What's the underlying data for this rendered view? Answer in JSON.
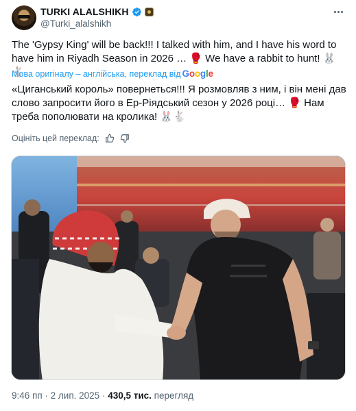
{
  "author": {
    "display_name": "TURKI ALALSHIKH",
    "handle": "@Turki_alalshikh"
  },
  "tweet": {
    "text_part1": "The 'Gypsy King' will be back!!! I talked with him, and I have his word to have him in Riyadh Season in 2026 … ",
    "text_part2": " We have a rabbit to hunt! ",
    "glove_emoji": "🥊",
    "rabbit_emoji": "🐰🐇"
  },
  "translation": {
    "note": "Мова оригіналу – англійська, переклад від",
    "provider": "Google",
    "text_part1": "«Циганський король» повернеться!!! Я розмовляв з ним, і він мені дав слово запросити його в Ер-Ріядський сезон у 2026 році… ",
    "text_part2": " Нам треба пополювати на кролика! ",
    "rate_label": "Оцініть цей переклад:"
  },
  "meta": {
    "time": "9:46 пп",
    "separator": " · ",
    "date": "2 лип. 2025",
    "views": "430,5 тис.",
    "views_label": " перегляд"
  },
  "colors": {
    "accent": "#1d9bf0",
    "text": "#0f1419",
    "muted": "#536471"
  }
}
